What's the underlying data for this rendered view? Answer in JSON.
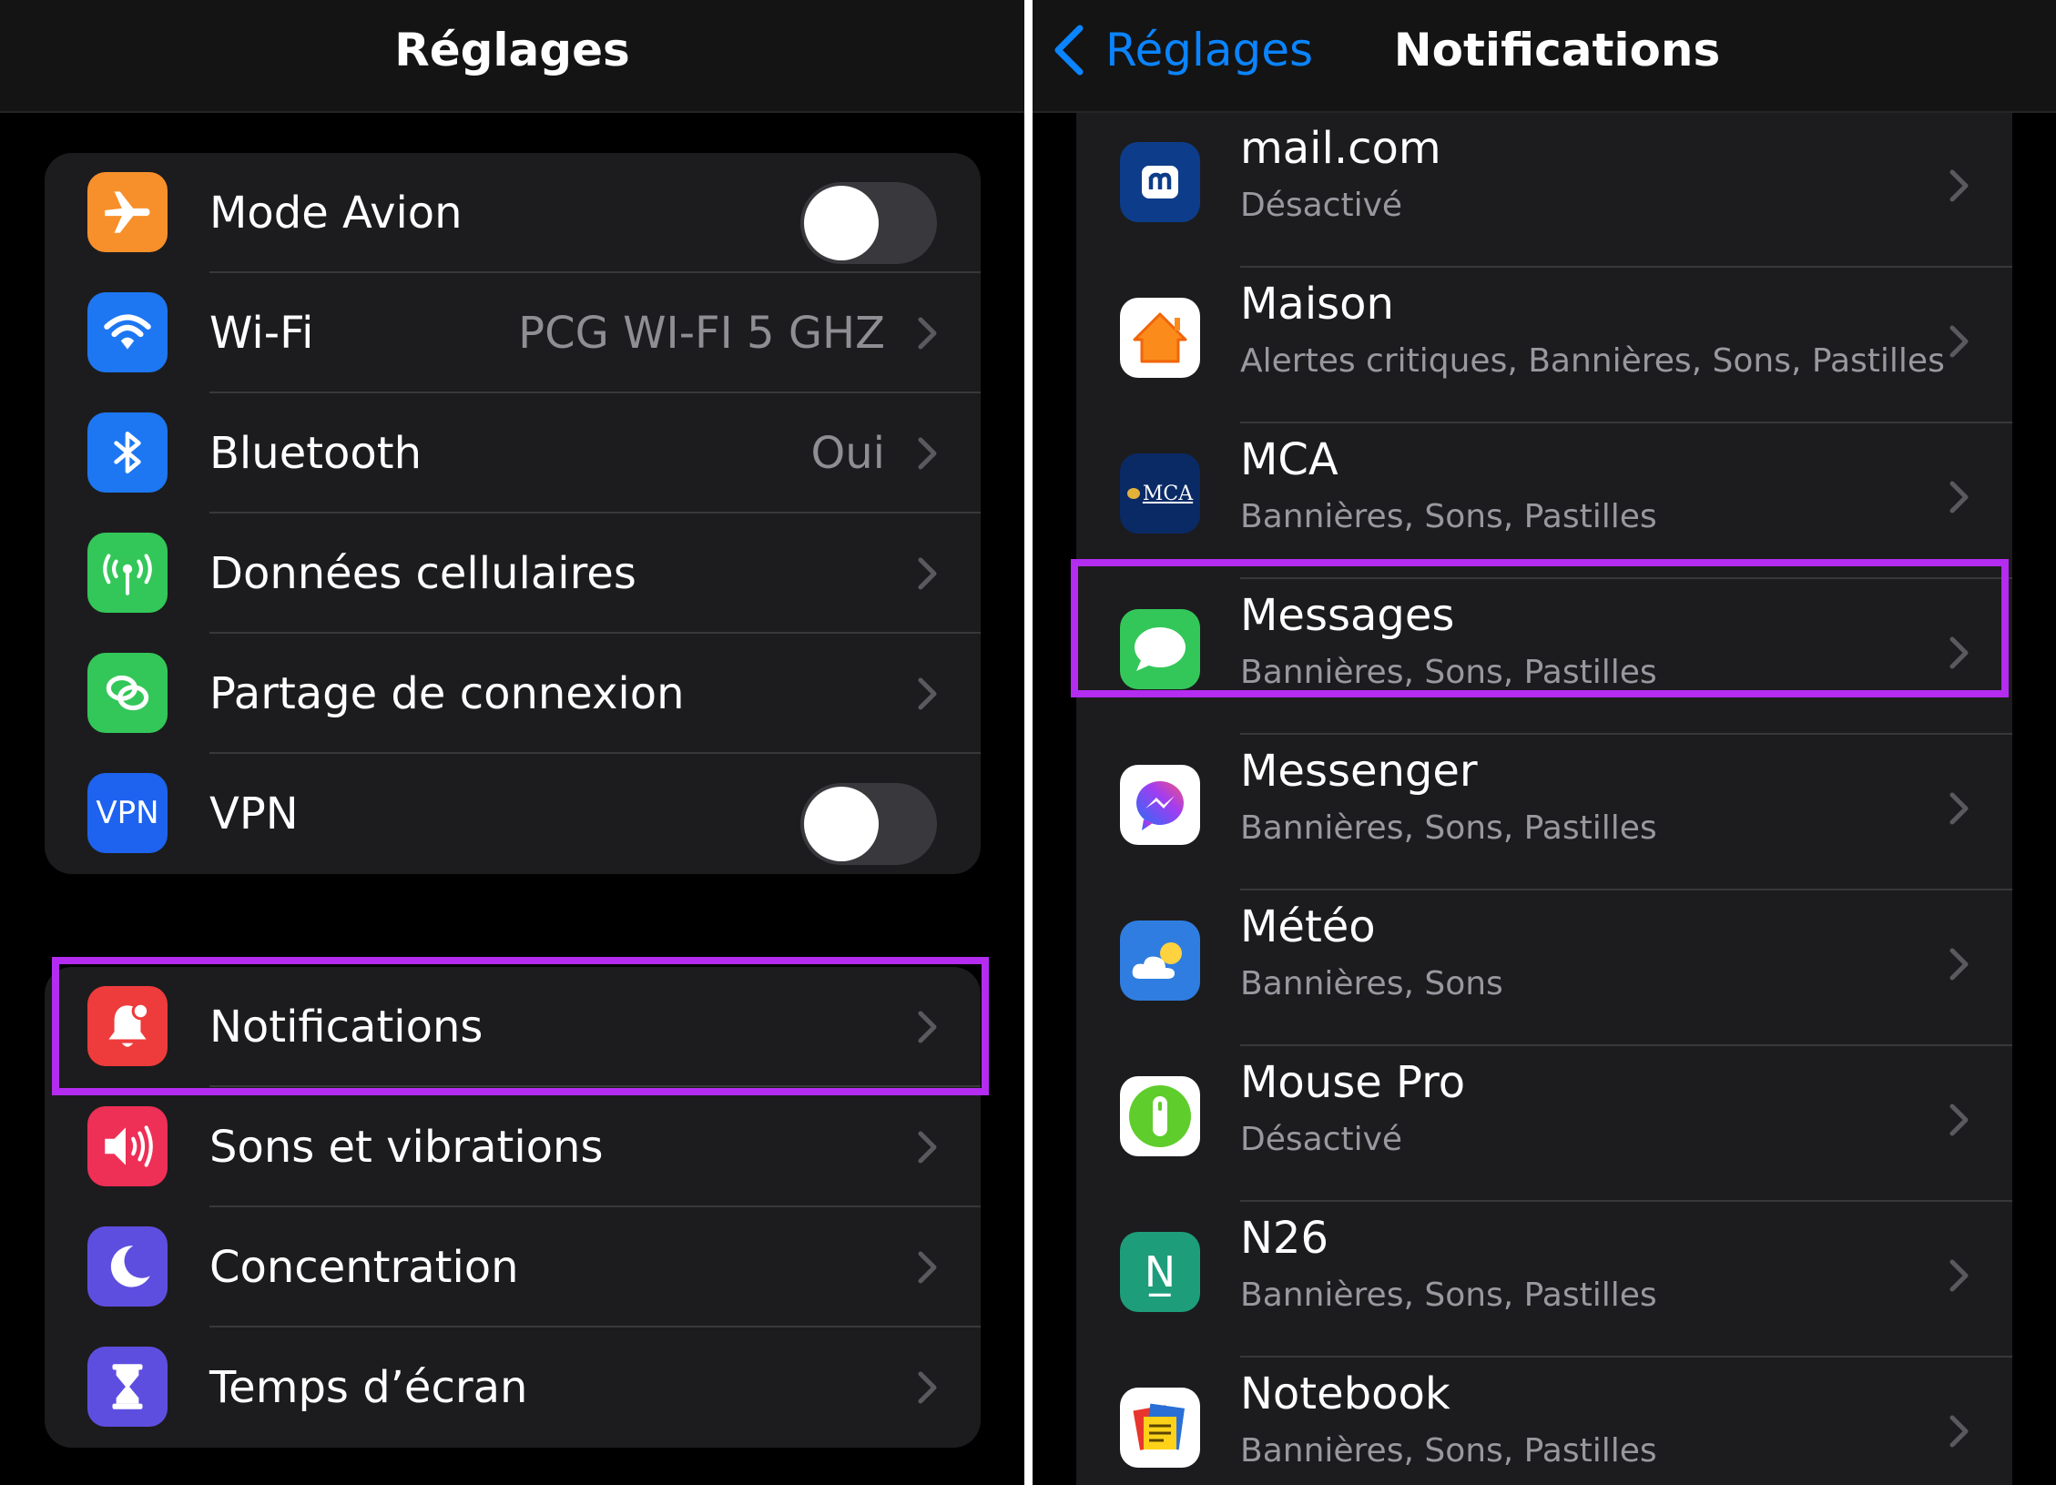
{
  "left": {
    "title": "Réglages",
    "group1": [
      {
        "label": "Mode Avion",
        "value": "",
        "icon": "airplane-icon",
        "color": "#f7902a",
        "toggle": true
      },
      {
        "label": "Wi-Fi",
        "value": "PCG WI-FI 5 GHZ",
        "icon": "wifi-icon",
        "color": "#1d77f2"
      },
      {
        "label": "Bluetooth",
        "value": "Oui",
        "icon": "bluetooth-icon",
        "color": "#1d77f2"
      },
      {
        "label": "Données cellulaires",
        "value": "",
        "icon": "antenna-icon",
        "color": "#33c759"
      },
      {
        "label": "Partage de connexion",
        "value": "",
        "icon": "link-icon",
        "color": "#33c759"
      },
      {
        "label": "VPN",
        "value": "",
        "icon": "vpn-icon",
        "color": "#1d63ef",
        "toggle": true,
        "icon_text": "VPN"
      }
    ],
    "group2": [
      {
        "label": "Notifications",
        "icon": "bell-icon",
        "color": "#ee3b3b"
      },
      {
        "label": "Sons et vibrations",
        "icon": "speaker-icon",
        "color": "#ee2f56"
      },
      {
        "label": "Concentration",
        "icon": "moon-icon",
        "color": "#5e4ee0"
      },
      {
        "label": "Temps d’écran",
        "icon": "hourglass-icon",
        "color": "#5e4ee0"
      }
    ]
  },
  "right": {
    "back_label": "Réglages",
    "title": "Notifications",
    "apps": [
      {
        "name": "mail.com",
        "subtitle": "Désactivé",
        "icon": "mailcom-icon",
        "color": "#0d3d8a"
      },
      {
        "name": "Maison",
        "subtitle": "Alertes critiques, Bannières, Sons, Pastilles",
        "icon": "home-icon",
        "color": "#ffffff"
      },
      {
        "name": "MCA",
        "subtitle": "Bannières, Sons, Pastilles",
        "icon": "mca-icon",
        "color": "#0a2a66",
        "icon_text": "MCA"
      },
      {
        "name": "Messages",
        "subtitle": "Bannières, Sons, Pastilles",
        "icon": "message-bubble-icon",
        "color": "#33c759"
      },
      {
        "name": "Messenger",
        "subtitle": "Bannières, Sons, Pastilles",
        "icon": "messenger-icon",
        "color": "#ffffff"
      },
      {
        "name": "Météo",
        "subtitle": "Bannières, Sons",
        "icon": "weather-icon",
        "color": "#2f7de0"
      },
      {
        "name": "Mouse Pro",
        "subtitle": "Désactivé",
        "icon": "mouse-icon",
        "color": "#ffffff"
      },
      {
        "name": "N26",
        "subtitle": "Bannières, Sons, Pastilles",
        "icon": "n26-icon",
        "color": "#1e9d7a",
        "icon_text": "N̲"
      },
      {
        "name": "Notebook",
        "subtitle": "Bannières, Sons, Pastilles",
        "icon": "notebook-icon",
        "color": "#ffffff"
      }
    ]
  },
  "highlight_color": "#b32cef"
}
